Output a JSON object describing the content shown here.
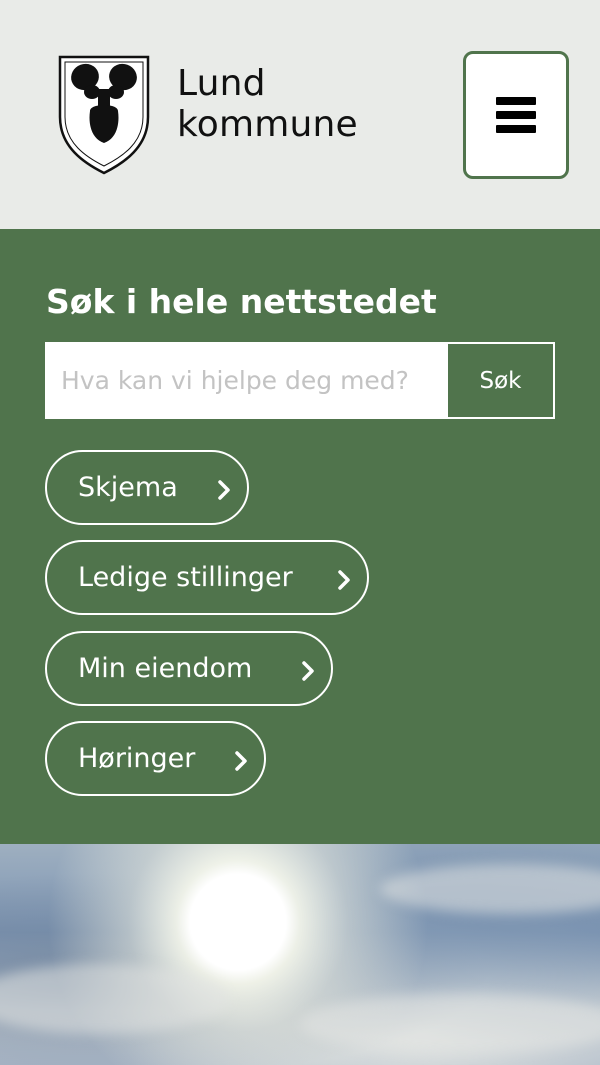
{
  "header": {
    "logo_line1": "Lund",
    "logo_line2": "kommune",
    "menu_icon": "hamburger-icon"
  },
  "search": {
    "title": "Søk i hele nettstedet",
    "placeholder": "Hva kan vi hjelpe deg med?",
    "button_label": "Søk"
  },
  "quick_links": [
    {
      "label": "Skjema"
    },
    {
      "label": "Ledige stillinger"
    },
    {
      "label": "Min eiendom"
    },
    {
      "label": "Høringer"
    }
  ],
  "colors": {
    "brand_green": "#50744c",
    "header_bg": "#e9ebe8"
  }
}
